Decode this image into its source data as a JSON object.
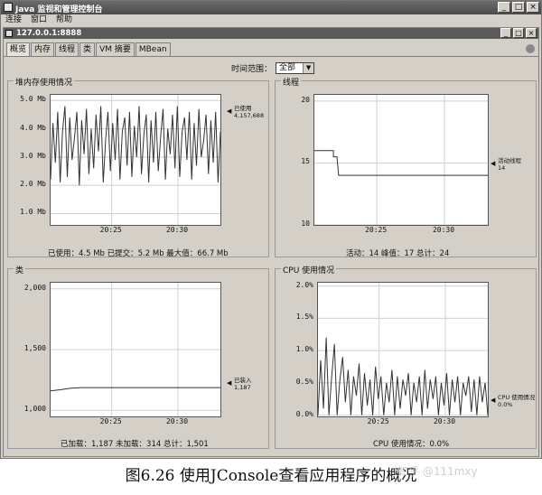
{
  "window": {
    "title": "Java 监视和管理控制台",
    "controls": [
      "_",
      "□",
      "×"
    ]
  },
  "menu": [
    "连接",
    "窗口",
    "帮助"
  ],
  "connection": {
    "title": "127.0.0.1:8888",
    "controls": [
      "_",
      "□",
      "×"
    ]
  },
  "tabs": [
    "概览",
    "内存",
    "线程",
    "类",
    "VM 摘要",
    "MBean"
  ],
  "time_range": {
    "label": "时间范围：",
    "value": "全部"
  },
  "panels": {
    "heap": {
      "title": "堆内存使用情况",
      "legend": [
        "已使用",
        "4,157,688"
      ],
      "stats": "已使用：4.5 Mb    已提交：5.2 Mb    最大值：66.7 Mb"
    },
    "threads": {
      "title": "线程",
      "legend": [
        "活动线程",
        "14"
      ],
      "stats": "活动：14    峰值：17    总计：24"
    },
    "classes": {
      "title": "类",
      "legend": [
        "已装入",
        "1,187"
      ],
      "stats": "已加载：1,187    未加载：314    总计：1,501"
    },
    "cpu": {
      "title": "CPU 使用情况",
      "legend": [
        "CPU 使用情况",
        "0.0%"
      ],
      "stats": "CPU 使用情况：0.0%"
    }
  },
  "caption": "图6.26    使用JConsole查看应用程序的概况",
  "watermark": "知乎 @111mxy",
  "chart_data": [
    {
      "type": "line",
      "title": "堆内存使用情况",
      "x_ticks": [
        "20:25",
        "20:30"
      ],
      "y_ticks": [
        "1.0 Mb",
        "2.0 Mb",
        "3.0 Mb",
        "4.0 Mb",
        "5.0 Mb"
      ],
      "ylim": [
        0.6,
        5.2
      ],
      "series": [
        {
          "name": "已使用",
          "values": [
            2.2,
            4.2,
            2.8,
            4.6,
            2.1,
            3.9,
            4.8,
            2.3,
            4.4,
            2.9,
            3.7,
            4.6,
            2.0,
            4.3,
            3.1,
            4.7,
            2.4,
            4.0,
            2.6,
            4.5,
            3.2,
            4.8,
            2.1,
            3.6,
            4.6,
            2.5,
            4.2,
            2.9,
            4.7,
            2.2,
            3.9,
            4.4,
            2.7,
            4.6,
            2.3,
            4.1,
            3.0,
            4.8,
            2.4,
            3.8,
            4.5,
            2.1,
            4.3,
            2.8,
            4.6,
            2.5,
            3.7,
            4.7,
            2.2,
            4.0,
            3.1,
            4.5,
            2.6,
            4.8,
            2.3,
            3.9,
            4.4,
            2.9,
            4.6,
            2.2,
            4.2,
            2.7,
            4.7,
            3.0,
            3.6,
            4.5,
            2.4,
            4.3,
            2.8,
            4.6,
            2.1,
            3.9
          ]
        }
      ]
    },
    {
      "type": "line",
      "title": "线程",
      "x_ticks": [
        "20:25",
        "20:30"
      ],
      "y_ticks": [
        "10",
        "15",
        "20"
      ],
      "ylim": [
        10,
        20.5
      ],
      "series": [
        {
          "name": "活动线程",
          "x": [
            0,
            0.11,
            0.11,
            0.13,
            0.14,
            0.15,
            1.0
          ],
          "values": [
            16,
            16,
            15.5,
            15.5,
            14,
            14,
            14
          ]
        }
      ]
    },
    {
      "type": "line",
      "title": "类",
      "x_ticks": [
        "20:25",
        "20:30"
      ],
      "y_ticks": [
        "1,000",
        "1,500",
        "2,000"
      ],
      "ylim": [
        950,
        2050
      ],
      "series": [
        {
          "name": "已装入",
          "x": [
            0,
            0.06,
            0.12,
            0.18,
            0.24,
            1.0
          ],
          "values": [
            1160,
            1170,
            1182,
            1187,
            1187,
            1187
          ]
        }
      ]
    },
    {
      "type": "line",
      "title": "CPU 使用情况",
      "x_ticks": [
        "20:25",
        "20:30"
      ],
      "y_ticks": [
        "0.0%",
        "0.5%",
        "1.0%",
        "1.5%",
        "2.0%"
      ],
      "ylim": [
        -0.02,
        2.05
      ],
      "series": [
        {
          "name": "CPU 使用情况",
          "values": [
            0.0,
            0.85,
            0.1,
            1.2,
            0.0,
            0.6,
            1.1,
            0.0,
            0.55,
            0.9,
            0.2,
            0.7,
            0.0,
            0.6,
            0.3,
            0.8,
            0.0,
            0.65,
            0.15,
            0.55,
            0.0,
            0.75,
            0.25,
            0.6,
            0.0,
            0.5,
            0.2,
            0.7,
            0.0,
            0.6,
            0.1,
            0.55,
            0.3,
            0.65,
            0.0,
            0.5,
            0.2,
            0.6,
            0.0,
            0.7,
            0.1,
            0.55,
            0.25,
            0.6,
            0.0,
            0.5,
            0.15,
            0.65,
            0.0,
            0.55,
            0.2,
            0.6,
            0.0,
            0.5,
            0.3,
            0.6,
            0.05,
            0.55,
            0.0,
            0.6,
            0.2,
            0.5,
            0.0
          ]
        }
      ]
    }
  ]
}
